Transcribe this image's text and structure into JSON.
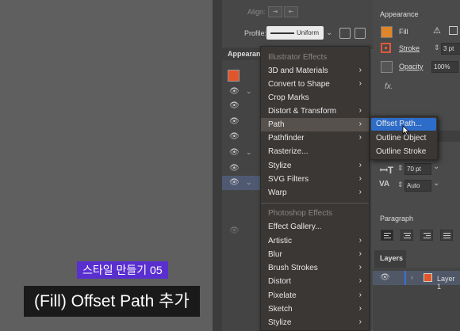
{
  "top_bar": {
    "align_label": "Align:",
    "profile_label": "Profile:",
    "profile_value": "Uniform"
  },
  "left_panel": {
    "tab_label": "Appearan"
  },
  "effects_menu": {
    "illustrator_header": "Illustrator Effects",
    "illustrator_items": [
      {
        "label": "3D and Materials",
        "submenu": true
      },
      {
        "label": "Convert to Shape",
        "submenu": true
      },
      {
        "label": "Crop Marks",
        "submenu": false
      },
      {
        "label": "Distort & Transform",
        "submenu": true
      },
      {
        "label": "Path",
        "submenu": true
      },
      {
        "label": "Pathfinder",
        "submenu": true
      },
      {
        "label": "Rasterize...",
        "submenu": false
      },
      {
        "label": "Stylize",
        "submenu": true
      },
      {
        "label": "SVG Filters",
        "submenu": true
      },
      {
        "label": "Warp",
        "submenu": true
      }
    ],
    "photoshop_header": "Photoshop Effects",
    "photoshop_items": [
      {
        "label": "Effect Gallery...",
        "submenu": false
      },
      {
        "label": "Artistic",
        "submenu": true
      },
      {
        "label": "Blur",
        "submenu": true
      },
      {
        "label": "Brush Strokes",
        "submenu": true
      },
      {
        "label": "Distort",
        "submenu": true
      },
      {
        "label": "Pixelate",
        "submenu": true
      },
      {
        "label": "Sketch",
        "submenu": true
      },
      {
        "label": "Stylize",
        "submenu": true
      }
    ],
    "highlighted": "Path"
  },
  "path_submenu": {
    "items": [
      "Offset Path...",
      "Outline Object",
      "Outline Stroke"
    ],
    "active_index": 0
  },
  "appearance_panel": {
    "title": "Appearance",
    "fill_label": "Fill",
    "stroke_label": "Stroke",
    "stroke_value": "3 pt",
    "opacity_label": "Opacity",
    "opacity_value": "100%",
    "fx_label": "fx."
  },
  "character": {
    "leading_value": "70 pt",
    "tracking_value": "Auto"
  },
  "paragraph": {
    "title": "Paragraph"
  },
  "layers": {
    "tab_label": "Layers",
    "layer_name": "Layer 1"
  },
  "captions": {
    "tag": "스타일 만들기 05",
    "main": "(Fill) Offset Path 추가"
  },
  "colors": {
    "accent_blue": "#2d6cc8",
    "caption_purple": "#5a2fd0",
    "swatch_orange": "#e0562a"
  }
}
